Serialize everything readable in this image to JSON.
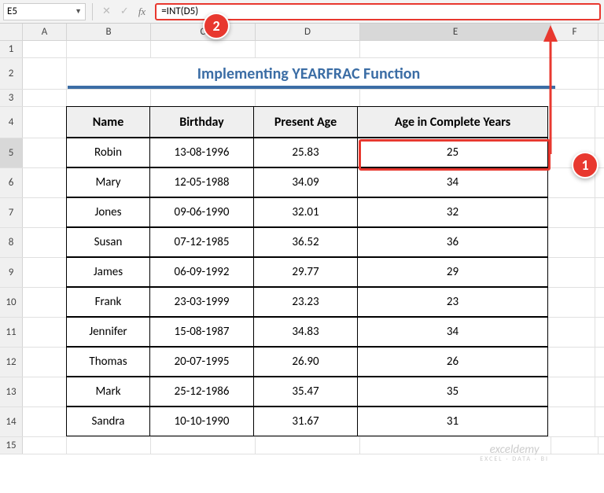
{
  "name_box": "E5",
  "formula": "=INT(D5)",
  "title": "Implementing YEARFRAC Function",
  "columns": [
    "A",
    "B",
    "C",
    "D",
    "E",
    "F"
  ],
  "row_numbers": [
    "1",
    "2",
    "3",
    "4",
    "5",
    "6",
    "7",
    "8",
    "9",
    "10",
    "11",
    "12",
    "13",
    "14",
    "15"
  ],
  "selected_row": "5",
  "selected_col": "E",
  "table": {
    "headers": {
      "name": "Name",
      "birthday": "Birthday",
      "present_age": "Present Age",
      "age_complete": "Age in Complete Years"
    },
    "rows": [
      {
        "name": "Robin",
        "birthday": "13-08-1996",
        "present_age": "25.83",
        "age_complete": "25"
      },
      {
        "name": "Mary",
        "birthday": "12-05-1988",
        "present_age": "34.09",
        "age_complete": "34"
      },
      {
        "name": "Jones",
        "birthday": "09-06-1990",
        "present_age": "32.01",
        "age_complete": "32"
      },
      {
        "name": "Susan",
        "birthday": "07-12-1985",
        "present_age": "36.52",
        "age_complete": "36"
      },
      {
        "name": "James",
        "birthday": "06-09-1992",
        "present_age": "29.77",
        "age_complete": "29"
      },
      {
        "name": "Frank",
        "birthday": "23-03-1999",
        "present_age": "23.23",
        "age_complete": "23"
      },
      {
        "name": "Jennifer",
        "birthday": "15-08-1987",
        "present_age": "34.83",
        "age_complete": "34"
      },
      {
        "name": "Thomas",
        "birthday": "20-07-1995",
        "present_age": "26.90",
        "age_complete": "26"
      },
      {
        "name": "Mark",
        "birthday": "25-12-1986",
        "present_age": "35.47",
        "age_complete": "35"
      },
      {
        "name": "Sandra",
        "birthday": "10-10-1990",
        "present_age": "31.67",
        "age_complete": "31"
      }
    ]
  },
  "callouts": {
    "one": "1",
    "two": "2"
  },
  "watermark": {
    "brand": "exceldemy",
    "sub": "EXCEL · DATA · BI"
  }
}
